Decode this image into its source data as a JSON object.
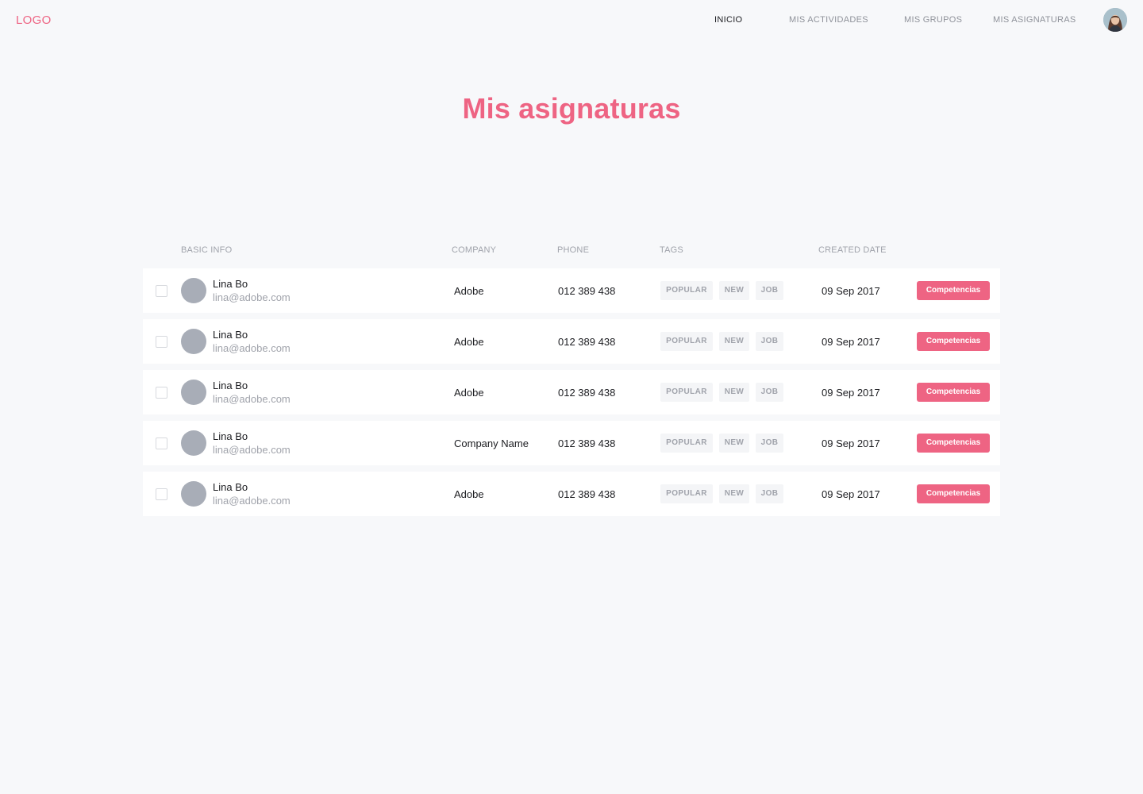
{
  "header": {
    "logo": "LOGO",
    "nav": [
      {
        "label": "INICIO",
        "active": true
      },
      {
        "label": "MIS ACTIVIDADES",
        "active": false
      },
      {
        "label": "MIS GRUPOS",
        "active": false
      },
      {
        "label": "MIS ASIGNATURAS",
        "active": false
      }
    ],
    "avatar_icon": "user-avatar-icon"
  },
  "page": {
    "title": "Mis asignaturas"
  },
  "table": {
    "columns": [
      "BASIC INFO",
      "COMPANY",
      "PHONE",
      "TAGS",
      "CREATED DATE"
    ],
    "rows": [
      {
        "name": "Lina Bo",
        "email": "lina@adobe.com",
        "company": "Adobe",
        "phone": "012 389 438",
        "tags": [
          "POPULAR",
          "NEW",
          "JOB"
        ],
        "date": "09 Sep 2017",
        "action": "Competencias",
        "checked": false
      },
      {
        "name": "Lina Bo",
        "email": "lina@adobe.com",
        "company": "Adobe",
        "phone": "012 389 438",
        "tags": [
          "POPULAR",
          "NEW",
          "JOB"
        ],
        "date": "09 Sep 2017",
        "action": "Competencias",
        "checked": false
      },
      {
        "name": "Lina Bo",
        "email": "lina@adobe.com",
        "company": "Adobe",
        "phone": "012 389 438",
        "tags": [
          "POPULAR",
          "NEW",
          "JOB"
        ],
        "date": "09 Sep 2017",
        "action": "Competencias",
        "checked": false
      },
      {
        "name": "Lina Bo",
        "email": "lina@adobe.com",
        "company": "Company Name",
        "phone": "012 389 438",
        "tags": [
          "POPULAR",
          "NEW",
          "JOB"
        ],
        "date": "09 Sep 2017",
        "action": "Competencias",
        "checked": false
      },
      {
        "name": "Lina Bo",
        "email": "lina@adobe.com",
        "company": "Adobe",
        "phone": "012 389 438",
        "tags": [
          "POPULAR",
          "NEW",
          "JOB"
        ],
        "date": "09 Sep 2017",
        "action": "Competencias",
        "checked": false
      }
    ]
  },
  "colors": {
    "accent": "#ee6483",
    "background": "#f7f8fa",
    "text": "#1c1d21",
    "muted": "#a0a3ab",
    "tag_background": "#f4f5f7",
    "avatar_placeholder": "#a8adb7"
  }
}
